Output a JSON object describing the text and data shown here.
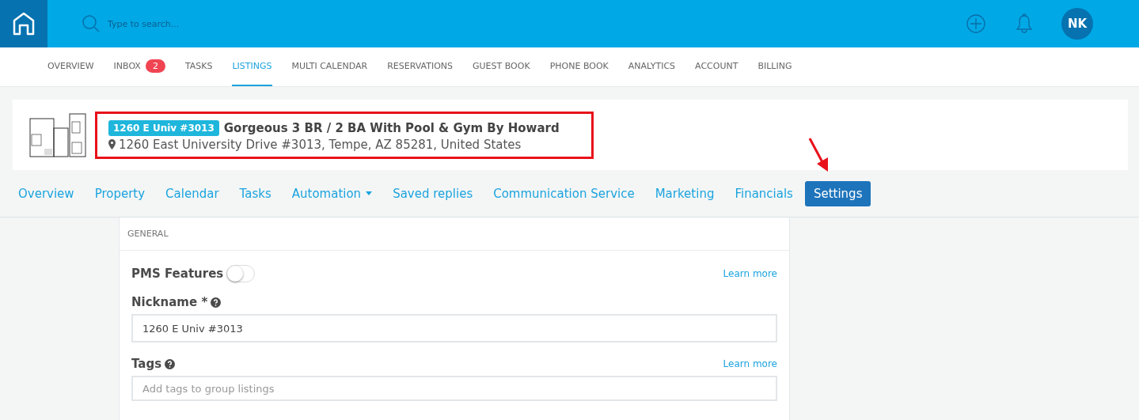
{
  "topbar": {
    "search": {
      "placeholder": "Type to search..."
    },
    "avatar": "NK"
  },
  "main_nav": [
    {
      "label": "OVERVIEW",
      "selected": false
    },
    {
      "label": "INBOX",
      "selected": false,
      "badge": "2"
    },
    {
      "label": "TASKS",
      "selected": false
    },
    {
      "label": "LISTINGS",
      "selected": true
    },
    {
      "label": "MULTI CALENDAR",
      "selected": false
    },
    {
      "label": "RESERVATIONS",
      "selected": false
    },
    {
      "label": "GUEST BOOK",
      "selected": false
    },
    {
      "label": "PHONE BOOK",
      "selected": false
    },
    {
      "label": "ANALYTICS",
      "selected": false
    },
    {
      "label": "ACCOUNT",
      "selected": false
    },
    {
      "label": "BILLING",
      "selected": false
    }
  ],
  "listing": {
    "nickname": "1260 E Univ #3013",
    "title": "Gorgeous 3 BR / 2 BA With Pool & Gym By Howard",
    "address": "1260 East University Drive #3013, Tempe, AZ 85281, United States"
  },
  "listing_tabs": [
    {
      "label": "Overview",
      "selected": false
    },
    {
      "label": "Property",
      "selected": false
    },
    {
      "label": "Calendar",
      "selected": false
    },
    {
      "label": "Tasks",
      "selected": false
    },
    {
      "label": "Automation",
      "selected": false,
      "dropdown": true
    },
    {
      "label": "Saved replies",
      "selected": false
    },
    {
      "label": "Communication Service",
      "selected": false
    },
    {
      "label": "Marketing",
      "selected": false
    },
    {
      "label": "Financials",
      "selected": false
    },
    {
      "label": "Settings",
      "selected": true
    }
  ],
  "general": {
    "heading": "GENERAL",
    "pms_features": {
      "label": "PMS Features",
      "on": false,
      "link": "Learn more"
    },
    "nickname": {
      "label": "Nickname *",
      "value": "1260 E Univ #3013"
    },
    "tags": {
      "label": "Tags",
      "placeholder": "Add tags to group listings",
      "link": "Learn more"
    }
  }
}
